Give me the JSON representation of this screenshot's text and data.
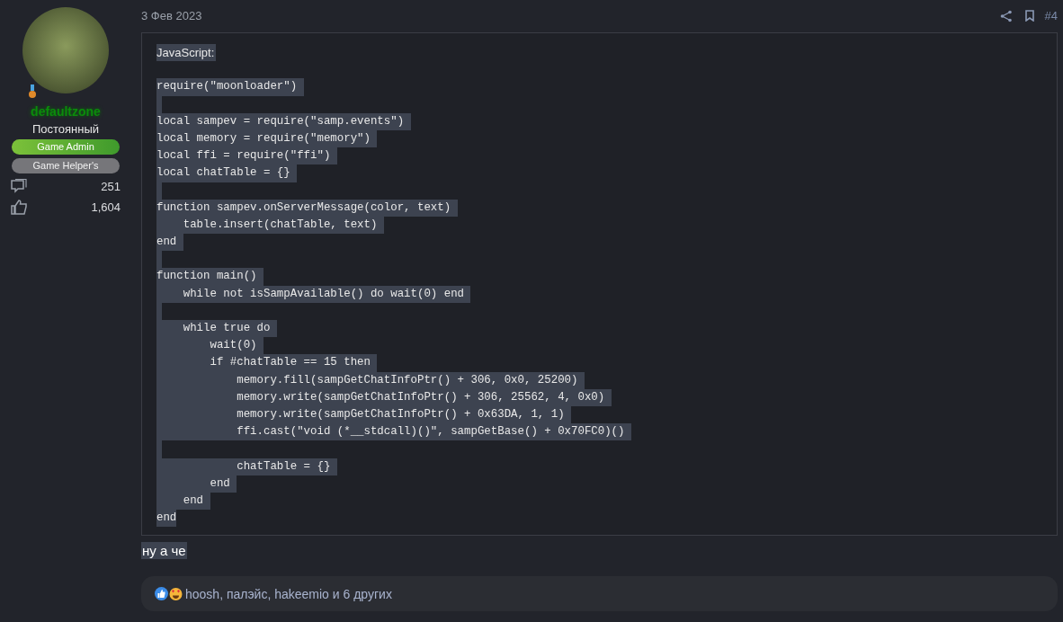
{
  "user": {
    "name": "defaultzone",
    "title": "Постоянный",
    "banners": [
      {
        "label": "Game Admin",
        "kind": "admin"
      },
      {
        "label": "Game Helper's",
        "kind": "helper"
      }
    ],
    "stats": [
      {
        "kind": "messages",
        "value": "251"
      },
      {
        "kind": "likes",
        "value": "1,604"
      }
    ]
  },
  "post": {
    "date": "3 Фев 2023",
    "number": "#4",
    "code_block": {
      "label": "JavaScript:",
      "code": "require(\"moonloader\") \n\nlocal sampev = require(\"samp.events\") \nlocal memory = require(\"memory\") \nlocal ffi = require(\"ffi\") \nlocal chatTable = {} \n\nfunction sampev.onServerMessage(color, text) \n    table.insert(chatTable, text) \nend \n\nfunction main() \n    while not isSampAvailable() do wait(0) end \n\n    while true do \n        wait(0) \n        if #chatTable == 15 then \n            memory.fill(sampGetChatInfoPtr() + 306, 0x0, 25200) \n            memory.write(sampGetChatInfoPtr() + 306, 25562, 4, 0x0) \n            memory.write(sampGetChatInfoPtr() + 0x63DA, 1, 1) \n            ffi.cast(\"void (*__stdcall)()\", sampGetBase() + 0x70FC0)() \n\n            chatTable = {} \n        end \n    end \nend"
    },
    "message": "ну а че",
    "reactions": {
      "text": "hoosh, палэйс, hakeemio и 6 других"
    }
  }
}
